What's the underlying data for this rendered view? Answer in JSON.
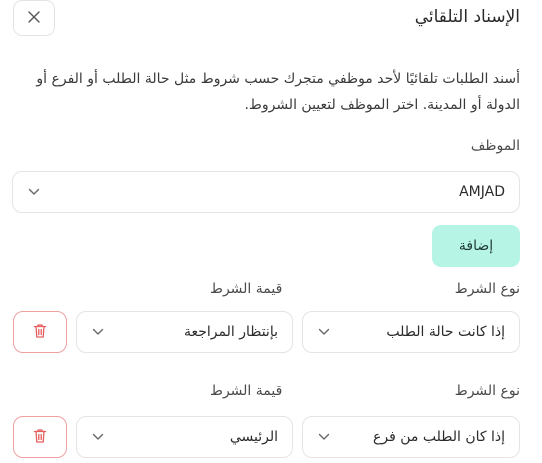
{
  "dialog": {
    "title": "الإسناد التلقائي",
    "description": "أسند الطلبات تلقائيًا لأحد موظفي متجرك حسب شروط مثل حالة الطلب أو الفرع أو الدولة أو المدينة. اختر الموظف لتعيين الشروط."
  },
  "employee": {
    "label": "الموظف",
    "value": "AMJAD"
  },
  "add_label": "إضافة",
  "conditions": [
    {
      "type_label": "نوع الشرط",
      "value_label": "قيمة الشرط",
      "type_value": "إذا كانت حالة الطلب",
      "condition_value": "بإنتظار المراجعة"
    },
    {
      "type_label": "نوع الشرط",
      "value_label": "قيمة الشرط",
      "type_value": "إذا كان الطلب من فرع",
      "condition_value": "الرئيسي"
    }
  ],
  "colors": {
    "accent": "#b6f4e6",
    "danger": "#e35d5d",
    "border": "#e4e4e4"
  },
  "icons": {
    "close": "close-icon",
    "chevron": "chevron-down-icon",
    "delete": "trash-icon"
  }
}
